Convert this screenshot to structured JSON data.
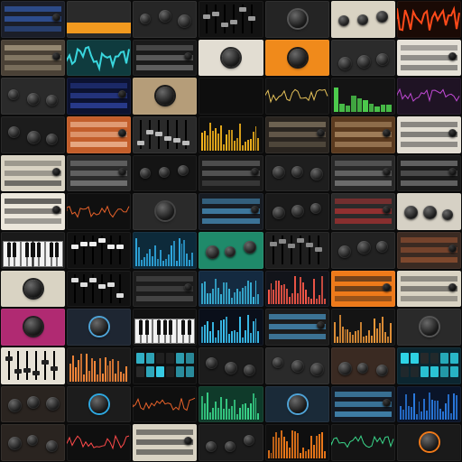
{
  "mosaic": {
    "rows": 12,
    "cols": 7,
    "labels": {
      "t0": "",
      "t1": "",
      "t2": "",
      "t3": "",
      "t4": "",
      "t5": "",
      "t6": ""
    }
  },
  "tiles": [
    {
      "bg": "#1b1e28",
      "type": "rack",
      "accent": "#3b6fd6"
    },
    {
      "bg": "#2a2a2a",
      "type": "stripe",
      "accent": "#f39a1f"
    },
    {
      "bg": "#262626",
      "type": "knobs",
      "accent": "#4a4a4a"
    },
    {
      "bg": "#121212",
      "type": "faders",
      "accent": "#9a9a9a"
    },
    {
      "bg": "#242424",
      "type": "bigknob",
      "accent": "#555"
    },
    {
      "bg": "#d9d3c3",
      "type": "knobs",
      "accent": "#2a2a2a"
    },
    {
      "bg": "#1a0a05",
      "type": "wave",
      "accent": "#ff4a1a"
    },
    {
      "bg": "#4a4136",
      "type": "rack",
      "accent": "#b3a58a"
    },
    {
      "bg": "#0f3b3e",
      "type": "wave",
      "accent": "#39d6dd"
    },
    {
      "bg": "#1a1a1a",
      "type": "rack",
      "accent": "#7a7a7a"
    },
    {
      "bg": "#e2ddd2",
      "type": "bigknob",
      "accent": "#2a2a2a"
    },
    {
      "bg": "#f08a1b",
      "type": "bigknob",
      "accent": "#1a1a1a"
    },
    {
      "bg": "#2b2b2b",
      "type": "knobs",
      "accent": "#555"
    },
    {
      "bg": "#e6e2d8",
      "type": "rack",
      "accent": "#333"
    },
    {
      "bg": "#2a2a2a",
      "type": "knobs",
      "accent": "#555"
    },
    {
      "bg": "#0c1230",
      "type": "rack",
      "accent": "#3a56c8"
    },
    {
      "bg": "#b59d79",
      "type": "bigknob",
      "accent": "#1a1a1a"
    },
    {
      "bg": "#0e0e0e",
      "type": "dark",
      "accent": "#333"
    },
    {
      "bg": "#121212",
      "type": "line",
      "accent": "#e6c25a"
    },
    {
      "bg": "#141414",
      "type": "meters",
      "accent": "#4fd34f"
    },
    {
      "bg": "#1f1324",
      "type": "line",
      "accent": "#c24ad6"
    },
    {
      "bg": "#1c1c1c",
      "type": "knobs",
      "accent": "#4a4a4a"
    },
    {
      "bg": "#c35e2b",
      "type": "rack",
      "accent": "#f2c0a0"
    },
    {
      "bg": "#2a2a2a",
      "type": "faders",
      "accent": "#bbb"
    },
    {
      "bg": "#0f0f0f",
      "type": "bars",
      "accent": "#f2b21c"
    },
    {
      "bg": "#2a2520",
      "type": "rack",
      "accent": "#8a7c66"
    },
    {
      "bg": "#5a3a1f",
      "type": "rack",
      "accent": "#d6b487"
    },
    {
      "bg": "#e2ddd2",
      "type": "rack",
      "accent": "#333"
    },
    {
      "bg": "#d9d3c3",
      "type": "rack",
      "accent": "#333"
    },
    {
      "bg": "#2b2b2b",
      "type": "rack",
      "accent": "#888"
    },
    {
      "bg": "#141414",
      "type": "knobs",
      "accent": "#444"
    },
    {
      "bg": "#1a1a1a",
      "type": "rack",
      "accent": "#6a6a6a"
    },
    {
      "bg": "#1e1e1e",
      "type": "knobs",
      "accent": "#e0532a"
    },
    {
      "bg": "#272727",
      "type": "rack",
      "accent": "#888"
    },
    {
      "bg": "#1a1a1a",
      "type": "rack",
      "accent": "#7a7a7a"
    },
    {
      "bg": "#ece7db",
      "type": "rack",
      "accent": "#222"
    },
    {
      "bg": "#101010",
      "type": "line",
      "accent": "#e8622a"
    },
    {
      "bg": "#2a2a2a",
      "type": "bigknob",
      "accent": "#444"
    },
    {
      "bg": "#181c22",
      "type": "rack",
      "accent": "#4fa3d6"
    },
    {
      "bg": "#1a1a1a",
      "type": "knobs",
      "accent": "#444"
    },
    {
      "bg": "#2a2a2a",
      "type": "rack",
      "accent": "#b33"
    },
    {
      "bg": "#d6d1c5",
      "type": "knobs",
      "accent": "#222"
    },
    {
      "bg": "#1a1a1a",
      "type": "keys",
      "accent": "#f2f2f2"
    },
    {
      "bg": "#111",
      "type": "faders",
      "accent": "#eee"
    },
    {
      "bg": "#0d2a3a",
      "type": "bars",
      "accent": "#2fa8e0"
    },
    {
      "bg": "#1f8a6a",
      "type": "knobs",
      "accent": "#0a0a0a"
    },
    {
      "bg": "#1e1e1e",
      "type": "faders",
      "accent": "#888"
    },
    {
      "bg": "#222",
      "type": "knobs",
      "accent": "#444"
    },
    {
      "bg": "#3a2a22",
      "type": "rack",
      "accent": "#c86a3a"
    },
    {
      "bg": "#d9d3c3",
      "type": "bigknob",
      "accent": "#222"
    },
    {
      "bg": "#111",
      "type": "faders",
      "accent": "#ddd"
    },
    {
      "bg": "#1c1c1c",
      "type": "rack",
      "accent": "#555"
    },
    {
      "bg": "#142a40",
      "type": "bars",
      "accent": "#39b6dd"
    },
    {
      "bg": "#12141a",
      "type": "bars",
      "accent": "#ff5a4a"
    },
    {
      "bg": "#ee7a1a",
      "type": "rack",
      "accent": "#1a1a1a"
    },
    {
      "bg": "#d9d3c3",
      "type": "rack",
      "accent": "#333"
    },
    {
      "bg": "#b02a72",
      "type": "bigknob",
      "accent": "#222"
    },
    {
      "bg": "#1e2632",
      "type": "bigknob",
      "accent": "#4fa3d6"
    },
    {
      "bg": "#111",
      "type": "keys",
      "accent": "#f2f2f2"
    },
    {
      "bg": "#0a0f1a",
      "type": "bars",
      "accent": "#3ac0f0"
    },
    {
      "bg": "#1c1c1c",
      "type": "rack",
      "accent": "#4fa3d6"
    },
    {
      "bg": "#141414",
      "type": "bars",
      "accent": "#f29a3a"
    },
    {
      "bg": "#2a2a2a",
      "type": "bigknob",
      "accent": "#555"
    },
    {
      "bg": "#e6e1d5",
      "type": "faders",
      "accent": "#222"
    },
    {
      "bg": "#1a1a1a",
      "type": "bars",
      "accent": "#ff8a3a"
    },
    {
      "bg": "#0f0f0f",
      "type": "pads",
      "accent": "#3ad6f0"
    },
    {
      "bg": "#1c1c1c",
      "type": "knobs",
      "accent": "#444"
    },
    {
      "bg": "#2a2a2a",
      "type": "knobs",
      "accent": "#555"
    },
    {
      "bg": "#3a2a22",
      "type": "knobs",
      "accent": "#e8e8e8"
    },
    {
      "bg": "#0c2630",
      "type": "pads",
      "accent": "#2fd6e8"
    },
    {
      "bg": "#2a2420",
      "type": "knobs",
      "accent": "#3a3a3a"
    },
    {
      "bg": "#1c1c1c",
      "type": "bigknob",
      "accent": "#2fa8e0"
    },
    {
      "bg": "#0f0f0f",
      "type": "line",
      "accent": "#e8622a"
    },
    {
      "bg": "#0f3a2a",
      "type": "bars",
      "accent": "#39d68a"
    },
    {
      "bg": "#1a2a38",
      "type": "bigknob",
      "accent": "#4fa3d6"
    },
    {
      "bg": "#141a24",
      "type": "rack",
      "accent": "#4fa3d6"
    },
    {
      "bg": "#0a1428",
      "type": "bars",
      "accent": "#2a7ae0"
    },
    {
      "bg": "#2a2420",
      "type": "knobs",
      "accent": "#3a3a3a"
    },
    {
      "bg": "#0f0f0f",
      "type": "line",
      "accent": "#ff4a4a"
    },
    {
      "bg": "#d9d3c3",
      "type": "rack",
      "accent": "#333"
    },
    {
      "bg": "#1c1c1c",
      "type": "knobs",
      "accent": "#444"
    },
    {
      "bg": "#0f0f0f",
      "type": "bars",
      "accent": "#f07a1a"
    },
    {
      "bg": "#141414",
      "type": "line",
      "accent": "#3ad68a"
    },
    {
      "bg": "#1a1a1a",
      "type": "bigknob",
      "accent": "#f07a1a"
    }
  ]
}
